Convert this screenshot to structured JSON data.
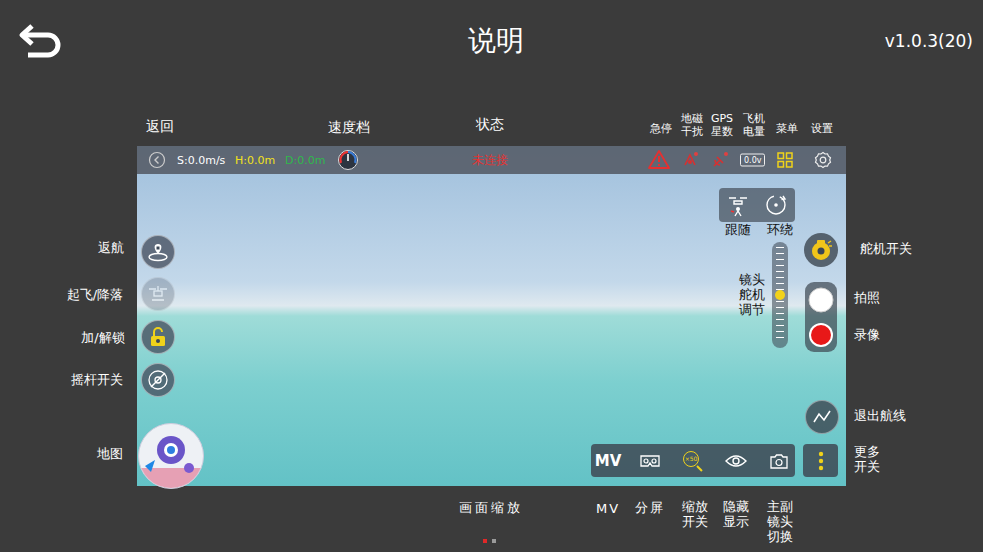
{
  "header": {
    "title": "说明",
    "version": "v1.0.3(20)"
  },
  "preview": {
    "top_bar": {
      "speed": "S:0.0m/s",
      "height": "H:0.0m",
      "distance": "D:0.0m",
      "status": "未连接",
      "battery": "0.0v"
    },
    "takeoff_disabled": true,
    "follow_label": "跟随",
    "orbit_label": "环绕",
    "gimbal_label": "镜头舵机调节",
    "gimbal_level": 0.5,
    "toolbar": {
      "mv": "MV",
      "zoom_badge": "×50"
    }
  },
  "callouts": [
    {
      "text": "返回"
    },
    {
      "text": "速度档"
    },
    {
      "text": "状态"
    },
    {
      "text": "急停"
    },
    {
      "text": "地磁干扰"
    },
    {
      "text": "GPS星数"
    },
    {
      "text": "飞机电量"
    },
    {
      "text": "菜单"
    },
    {
      "text": "设置"
    },
    {
      "text": "返航"
    },
    {
      "text": "起飞/降落"
    },
    {
      "text": "加/解锁"
    },
    {
      "text": "摇杆开关"
    },
    {
      "text": "地图"
    },
    {
      "text": "舵机开关"
    },
    {
      "text": "拍照"
    },
    {
      "text": "录像"
    },
    {
      "text": "退出航线"
    },
    {
      "text": "更多开关"
    },
    {
      "text": "画面缩放"
    },
    {
      "text": "MV"
    },
    {
      "text": "分屏"
    },
    {
      "text": "缩放开关"
    },
    {
      "text": "隐藏显示"
    },
    {
      "text": "主副镜头切换"
    }
  ],
  "pagination": [
    {
      "selected": true
    },
    {
      "selected": false
    }
  ]
}
